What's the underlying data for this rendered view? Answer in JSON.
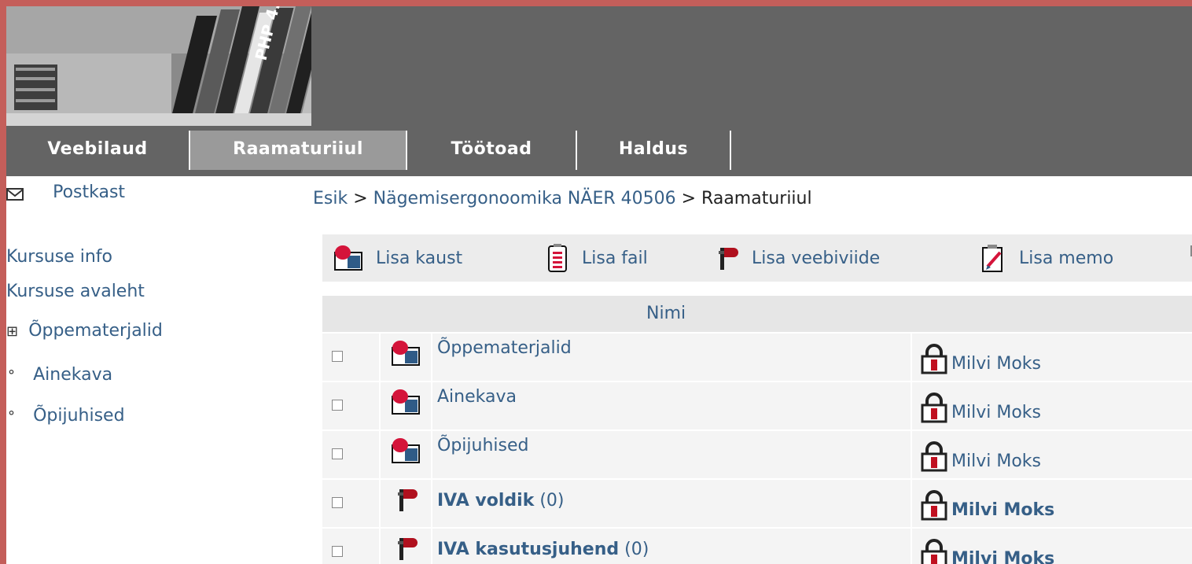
{
  "nav": {
    "tabs": [
      {
        "label": "Veebilaud"
      },
      {
        "label": "Raamaturiiul"
      },
      {
        "label": "Töötoad"
      },
      {
        "label": "Haldus"
      }
    ]
  },
  "sidebar": {
    "mailbox": "Postkast",
    "course_info": "Kursuse info",
    "course_home": "Kursuse avaleht",
    "tree_expand": "⊞",
    "tree_bullet": "°",
    "tree": [
      {
        "label": "Õppematerjalid"
      },
      {
        "label": "Ainekava"
      },
      {
        "label": "Õpijuhised"
      }
    ]
  },
  "breadcrumb": {
    "home": "Esik",
    "sep": " > ",
    "course": "Nägemisergonoomika NÄER 40506",
    "current": "Raamaturiiul"
  },
  "toolbar": {
    "add_folder": "Lisa kaust",
    "add_file": "Lisa fail",
    "add_weblink": "Lisa veebiviide",
    "add_memo": "Lisa memo"
  },
  "table": {
    "header_name": "Nimi",
    "rows": [
      {
        "type": "folder",
        "name": "Õppematerjalid",
        "count": "",
        "owner": "Milvi Moks"
      },
      {
        "type": "folder",
        "name": "Ainekava",
        "count": "",
        "owner": "Milvi Moks"
      },
      {
        "type": "folder",
        "name": "Õpijuhised",
        "count": "",
        "owner": "Milvi Moks"
      },
      {
        "type": "weblink",
        "name": "IVA voldik",
        "count": "(0)",
        "owner": "Milvi Moks"
      },
      {
        "type": "weblink",
        "name": "IVA kasutusjuhend",
        "count": "(0)",
        "owner": "Milvi Moks"
      }
    ]
  },
  "colors": {
    "frame": "#c45e5a",
    "header_bg": "#646464",
    "active_tab": "#9a9a9a",
    "link": "#365f87"
  }
}
